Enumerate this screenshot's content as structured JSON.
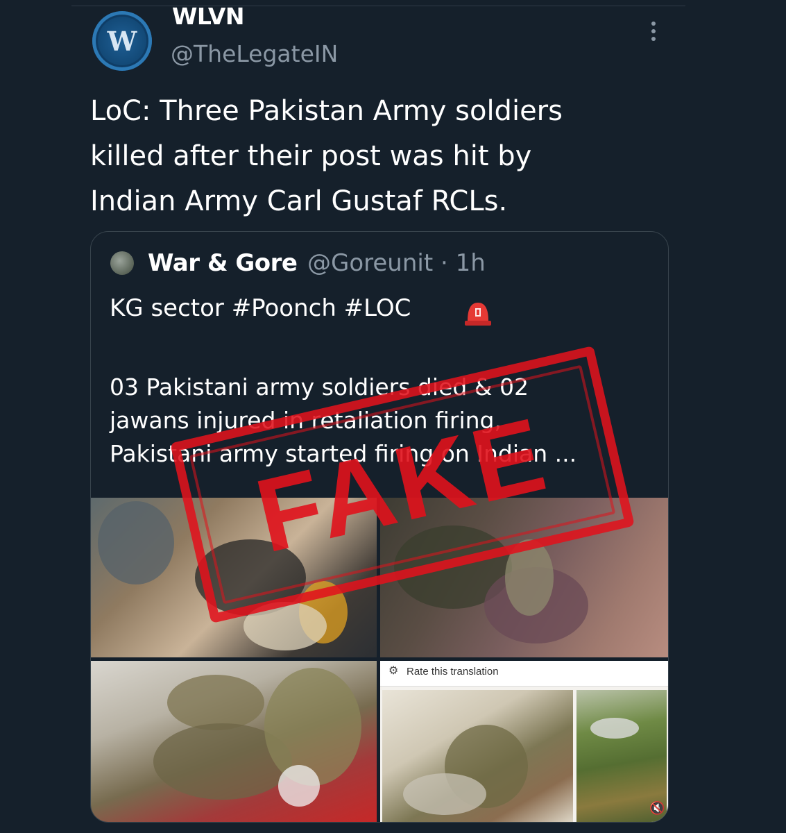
{
  "tweet": {
    "author_name": "WLVN",
    "author_handle": "@TheLegateIN",
    "avatar_letter": "W",
    "text": "LoC: Three Pakistan Army soldiers\nkilled after their post was hit by\nIndian Army Carl Gustaf RCLs."
  },
  "quoted": {
    "author_name": "War & Gore",
    "author_meta": "@Goreunit · 1h",
    "line1": "KG sector #Poonch #LOC",
    "body": "03 Pakistani army soldiers died & 02\njawans injured in retaliation firing,\nPakistani army started firing on Indian ...",
    "siren_icon": "police-siren-emoji",
    "media": {
      "translate_label": "Rate this translation"
    }
  },
  "stamp": {
    "word": "FAKE",
    "color": "#e0121c"
  },
  "colors": {
    "background": "#15202b",
    "secondary_text": "#8b98a5",
    "border": "#38444d"
  }
}
